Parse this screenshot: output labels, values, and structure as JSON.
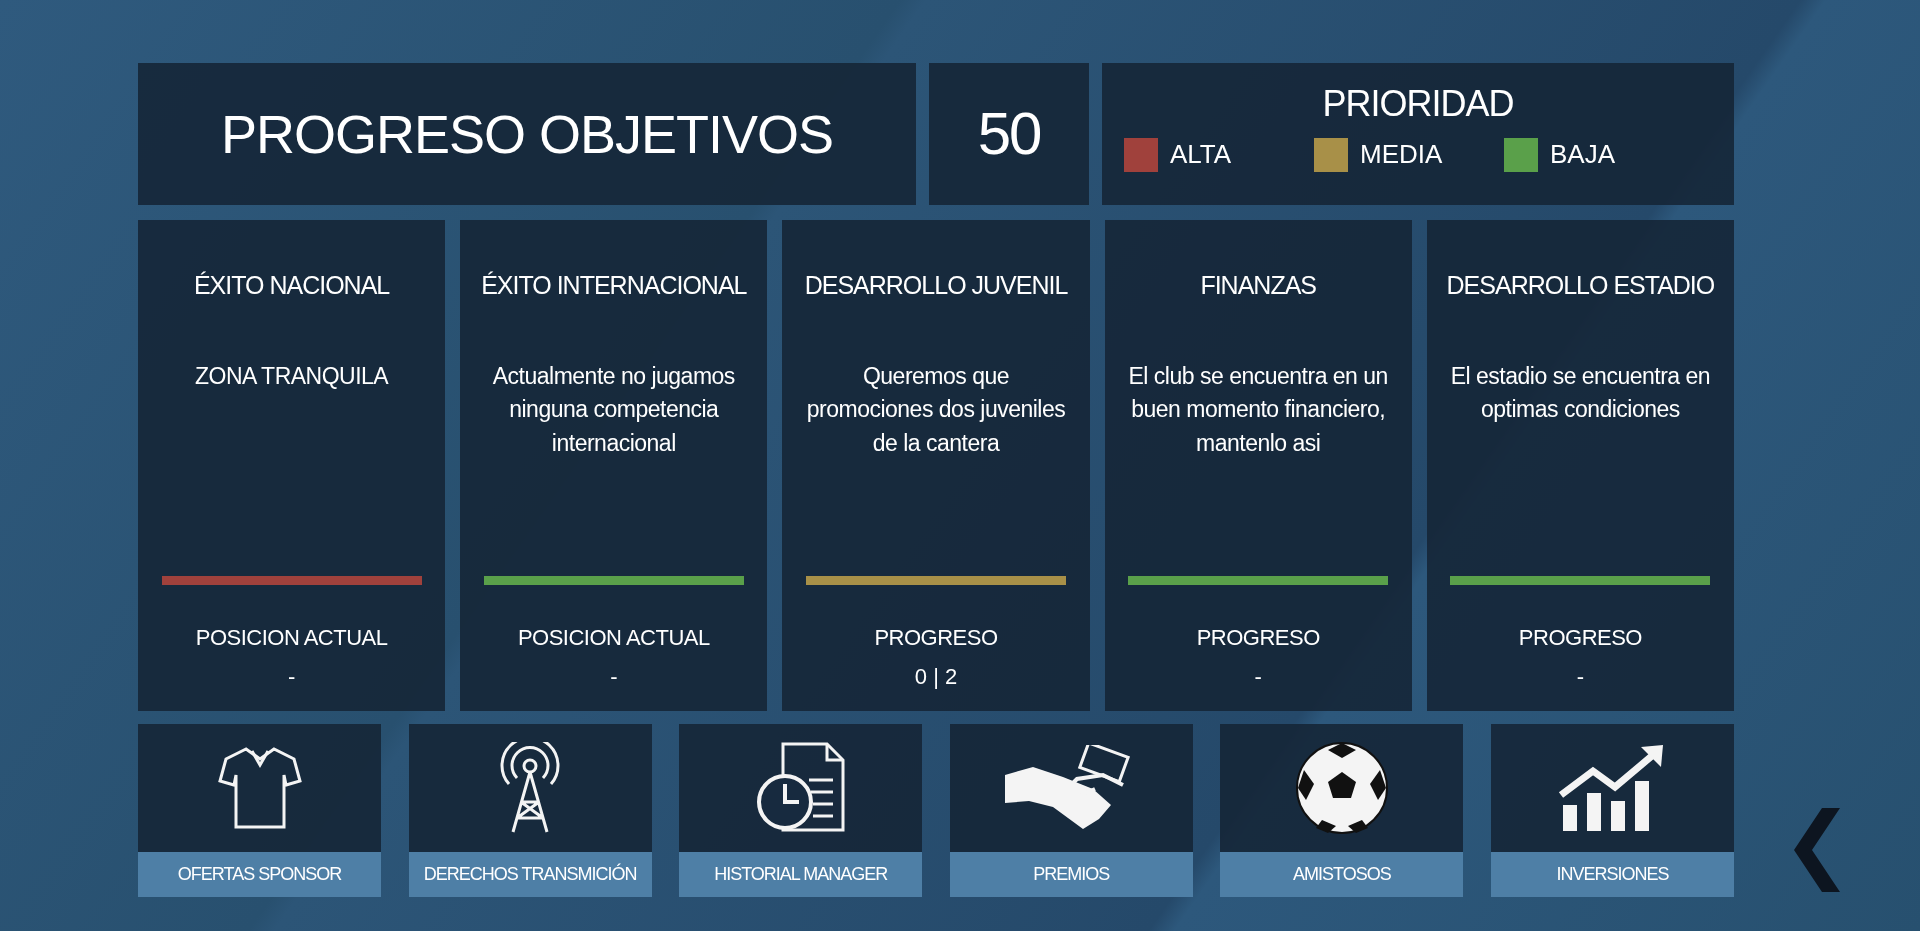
{
  "header": {
    "title": "PROGRESO OBJETIVOS",
    "score": "50"
  },
  "priority": {
    "title": "PRIORIDAD",
    "levels": [
      {
        "label": "ALTA",
        "color": "#a0413c"
      },
      {
        "label": "MEDIA",
        "color": "#a89048"
      },
      {
        "label": "BAJA",
        "color": "#5aa04a"
      }
    ]
  },
  "objectives": [
    {
      "title": "ÉXITO NACIONAL",
      "description": "ZONA TRANQUILA",
      "color": "#a0413c",
      "metric_label": "POSICION ACTUAL",
      "metric_value": "-"
    },
    {
      "title": "ÉXITO INTERNACIONAL",
      "description": "Actualmente no jugamos ninguna competencia internacional",
      "color": "#5aa04a",
      "metric_label": "POSICION ACTUAL",
      "metric_value": "-"
    },
    {
      "title": "DESARROLLO JUVENIL",
      "description": "Queremos que promociones dos juveniles de la cantera",
      "color": "#a89048",
      "metric_label": "PROGRESO",
      "metric_value": "0 | 2"
    },
    {
      "title": "FINANZAS",
      "description": "El club se encuentra en un buen momento financiero, mantenlo asi",
      "color": "#5aa04a",
      "metric_label": "PROGRESO",
      "metric_value": "-"
    },
    {
      "title": "DESARROLLO ESTADIO",
      "description": "El estadio se encuentra en optimas condiciones",
      "color": "#5aa04a",
      "metric_label": "PROGRESO",
      "metric_value": "-"
    }
  ],
  "shortcuts": [
    {
      "label": "OFERTAS SPONSOR",
      "kind": "shirt"
    },
    {
      "label": "DERECHOS TRANSMICIÓN",
      "kind": "antenna"
    },
    {
      "label": "HISTORIAL MANAGER",
      "kind": "history"
    },
    {
      "label": "PREMIOS",
      "kind": "handshake"
    },
    {
      "label": "AMISTOSOS",
      "kind": "ball"
    },
    {
      "label": "INVERSIONES",
      "kind": "chart"
    }
  ]
}
